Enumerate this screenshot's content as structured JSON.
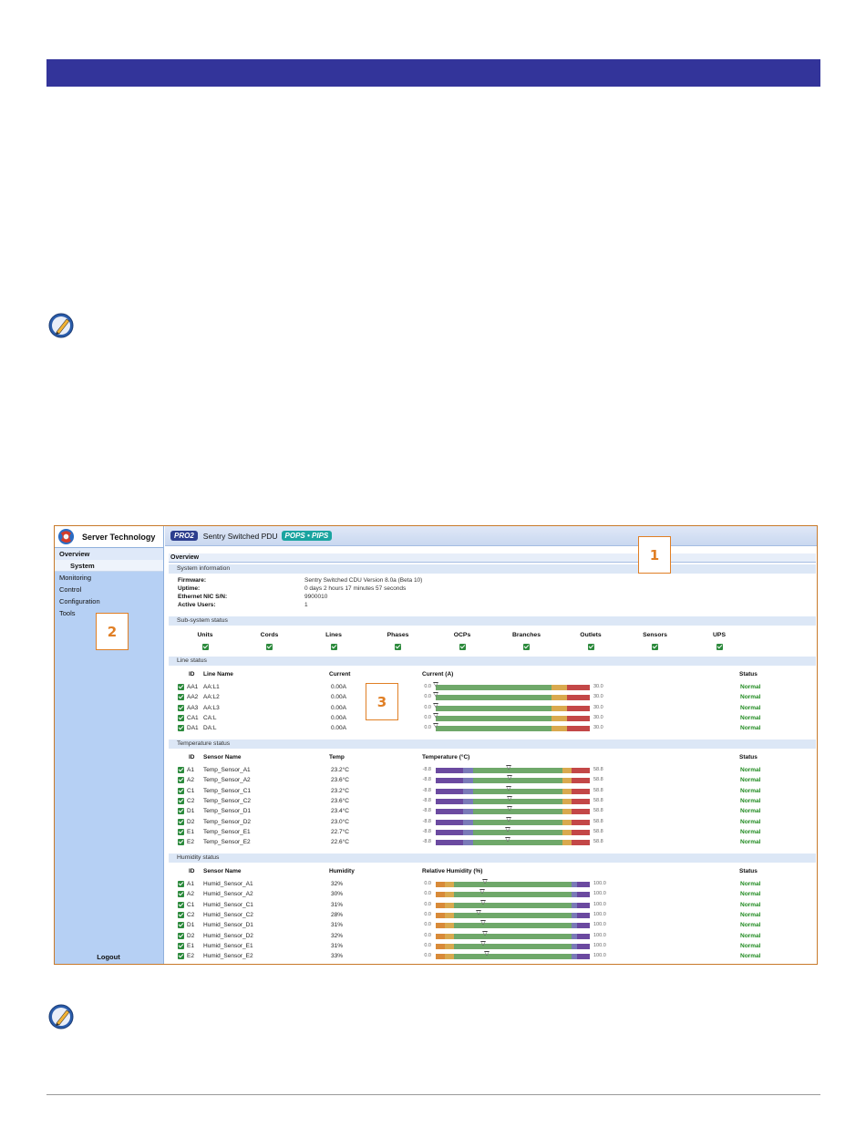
{
  "brand": {
    "name": "Server Technology"
  },
  "header": {
    "badge_left": "PRO2",
    "product": "Sentry Switched PDU",
    "badge_right": "POPS • PIPS"
  },
  "sidebar": {
    "items": [
      {
        "label": "Overview",
        "active": true
      },
      {
        "label": "System",
        "sub": true
      },
      {
        "label": "Monitoring"
      },
      {
        "label": "Control"
      },
      {
        "label": "Configuration"
      },
      {
        "label": "Tools"
      }
    ],
    "logout": "Logout"
  },
  "page": {
    "heading": "Overview"
  },
  "sections": {
    "system_info": "System information",
    "subsystem": "Sub-system status",
    "line": "Line status",
    "temperature": "Temperature status",
    "humidity": "Humidity status"
  },
  "system_info": {
    "labels": [
      "Firmware:",
      "Uptime:",
      "Ethernet NIC S/N:",
      "Active Users:"
    ],
    "values": [
      "Sentry Switched CDU Version 8.0a (Beta 10)",
      "0 days 2 hours 17 minutes 57 seconds",
      "9900010",
      "1"
    ]
  },
  "subsystem": [
    "Units",
    "Cords",
    "Lines",
    "Phases",
    "OCPs",
    "Branches",
    "Outlets",
    "Sensors",
    "UPS"
  ],
  "line_status": {
    "headers": {
      "id": "ID",
      "name": "Line Name",
      "value": "Current",
      "meter": "Current (A)",
      "status": "Status"
    },
    "meter": {
      "min": "0.0",
      "max": "30.0",
      "min_value": 0,
      "max_value": 30
    },
    "rows": [
      {
        "id": "AA1",
        "name": "AA:L1",
        "value": "0.00A",
        "level": 0,
        "status": "Normal"
      },
      {
        "id": "AA2",
        "name": "AA:L2",
        "value": "0.00A",
        "level": 0,
        "status": "Normal"
      },
      {
        "id": "AA3",
        "name": "AA:L3",
        "value": "0.00A",
        "level": 0,
        "status": "Normal"
      },
      {
        "id": "CA1",
        "name": "CA:L",
        "value": "0.00A",
        "level": 0,
        "status": "Normal"
      },
      {
        "id": "DA1",
        "name": "DA:L",
        "value": "0.00A",
        "level": 0,
        "status": "Normal"
      }
    ]
  },
  "temp_status": {
    "headers": {
      "id": "ID",
      "name": "Sensor Name",
      "value": "Temp",
      "meter": "Temperature (°C)",
      "status": "Status"
    },
    "meter": {
      "min": "-8.8",
      "max": "58.8",
      "min_value": -8.8,
      "max_value": 58.8
    },
    "rows": [
      {
        "id": "A1",
        "name": "Temp_Sensor_A1",
        "value": "23.2°C",
        "level": 23.2,
        "status": "Normal"
      },
      {
        "id": "A2",
        "name": "Temp_Sensor_A2",
        "value": "23.6°C",
        "level": 23.6,
        "status": "Normal"
      },
      {
        "id": "C1",
        "name": "Temp_Sensor_C1",
        "value": "23.2°C",
        "level": 23.2,
        "status": "Normal"
      },
      {
        "id": "C2",
        "name": "Temp_Sensor_C2",
        "value": "23.6°C",
        "level": 23.6,
        "status": "Normal"
      },
      {
        "id": "D1",
        "name": "Temp_Sensor_D1",
        "value": "23.4°C",
        "level": 23.4,
        "status": "Normal"
      },
      {
        "id": "D2",
        "name": "Temp_Sensor_D2",
        "value": "23.0°C",
        "level": 23.0,
        "status": "Normal"
      },
      {
        "id": "E1",
        "name": "Temp_Sensor_E1",
        "value": "22.7°C",
        "level": 22.7,
        "status": "Normal"
      },
      {
        "id": "E2",
        "name": "Temp_Sensor_E2",
        "value": "22.6°C",
        "level": 22.6,
        "status": "Normal"
      }
    ]
  },
  "humid_status": {
    "headers": {
      "id": "ID",
      "name": "Sensor Name",
      "value": "Humidity",
      "meter": "Relative Humidity (%)",
      "status": "Status"
    },
    "meter": {
      "min": "0.0",
      "max": "100.0",
      "min_value": 0,
      "max_value": 100
    },
    "rows": [
      {
        "id": "A1",
        "name": "Humid_Sensor_A1",
        "value": "32%",
        "level": 32,
        "status": "Normal"
      },
      {
        "id": "A2",
        "name": "Humid_Sensor_A2",
        "value": "30%",
        "level": 30,
        "status": "Normal"
      },
      {
        "id": "C1",
        "name": "Humid_Sensor_C1",
        "value": "31%",
        "level": 31,
        "status": "Normal"
      },
      {
        "id": "C2",
        "name": "Humid_Sensor_C2",
        "value": "28%",
        "level": 28,
        "status": "Normal"
      },
      {
        "id": "D1",
        "name": "Humid_Sensor_D1",
        "value": "31%",
        "level": 31,
        "status": "Normal"
      },
      {
        "id": "D2",
        "name": "Humid_Sensor_D2",
        "value": "32%",
        "level": 32,
        "status": "Normal"
      },
      {
        "id": "E1",
        "name": "Humid_Sensor_E1",
        "value": "31%",
        "level": 31,
        "status": "Normal"
      },
      {
        "id": "E2",
        "name": "Humid_Sensor_E2",
        "value": "33%",
        "level": 33,
        "status": "Normal"
      }
    ]
  },
  "callouts": [
    "1",
    "2",
    "3"
  ],
  "icons": {
    "note": "pencil-note-icon",
    "logo": "server-technology-logo-icon",
    "check": "checkbox-checked-icon"
  },
  "colors": {
    "banner": "#33349a",
    "sidebar": "#b6d0f4",
    "callout": "#e07f25",
    "status_ok": "#1f8a1f",
    "bar_ok": "#6fa86a",
    "bar_warn": "#d9a94e",
    "bar_crit": "#c34747",
    "bar_low": "#6b4aa0",
    "bar_humid_low": "#d88a38"
  }
}
